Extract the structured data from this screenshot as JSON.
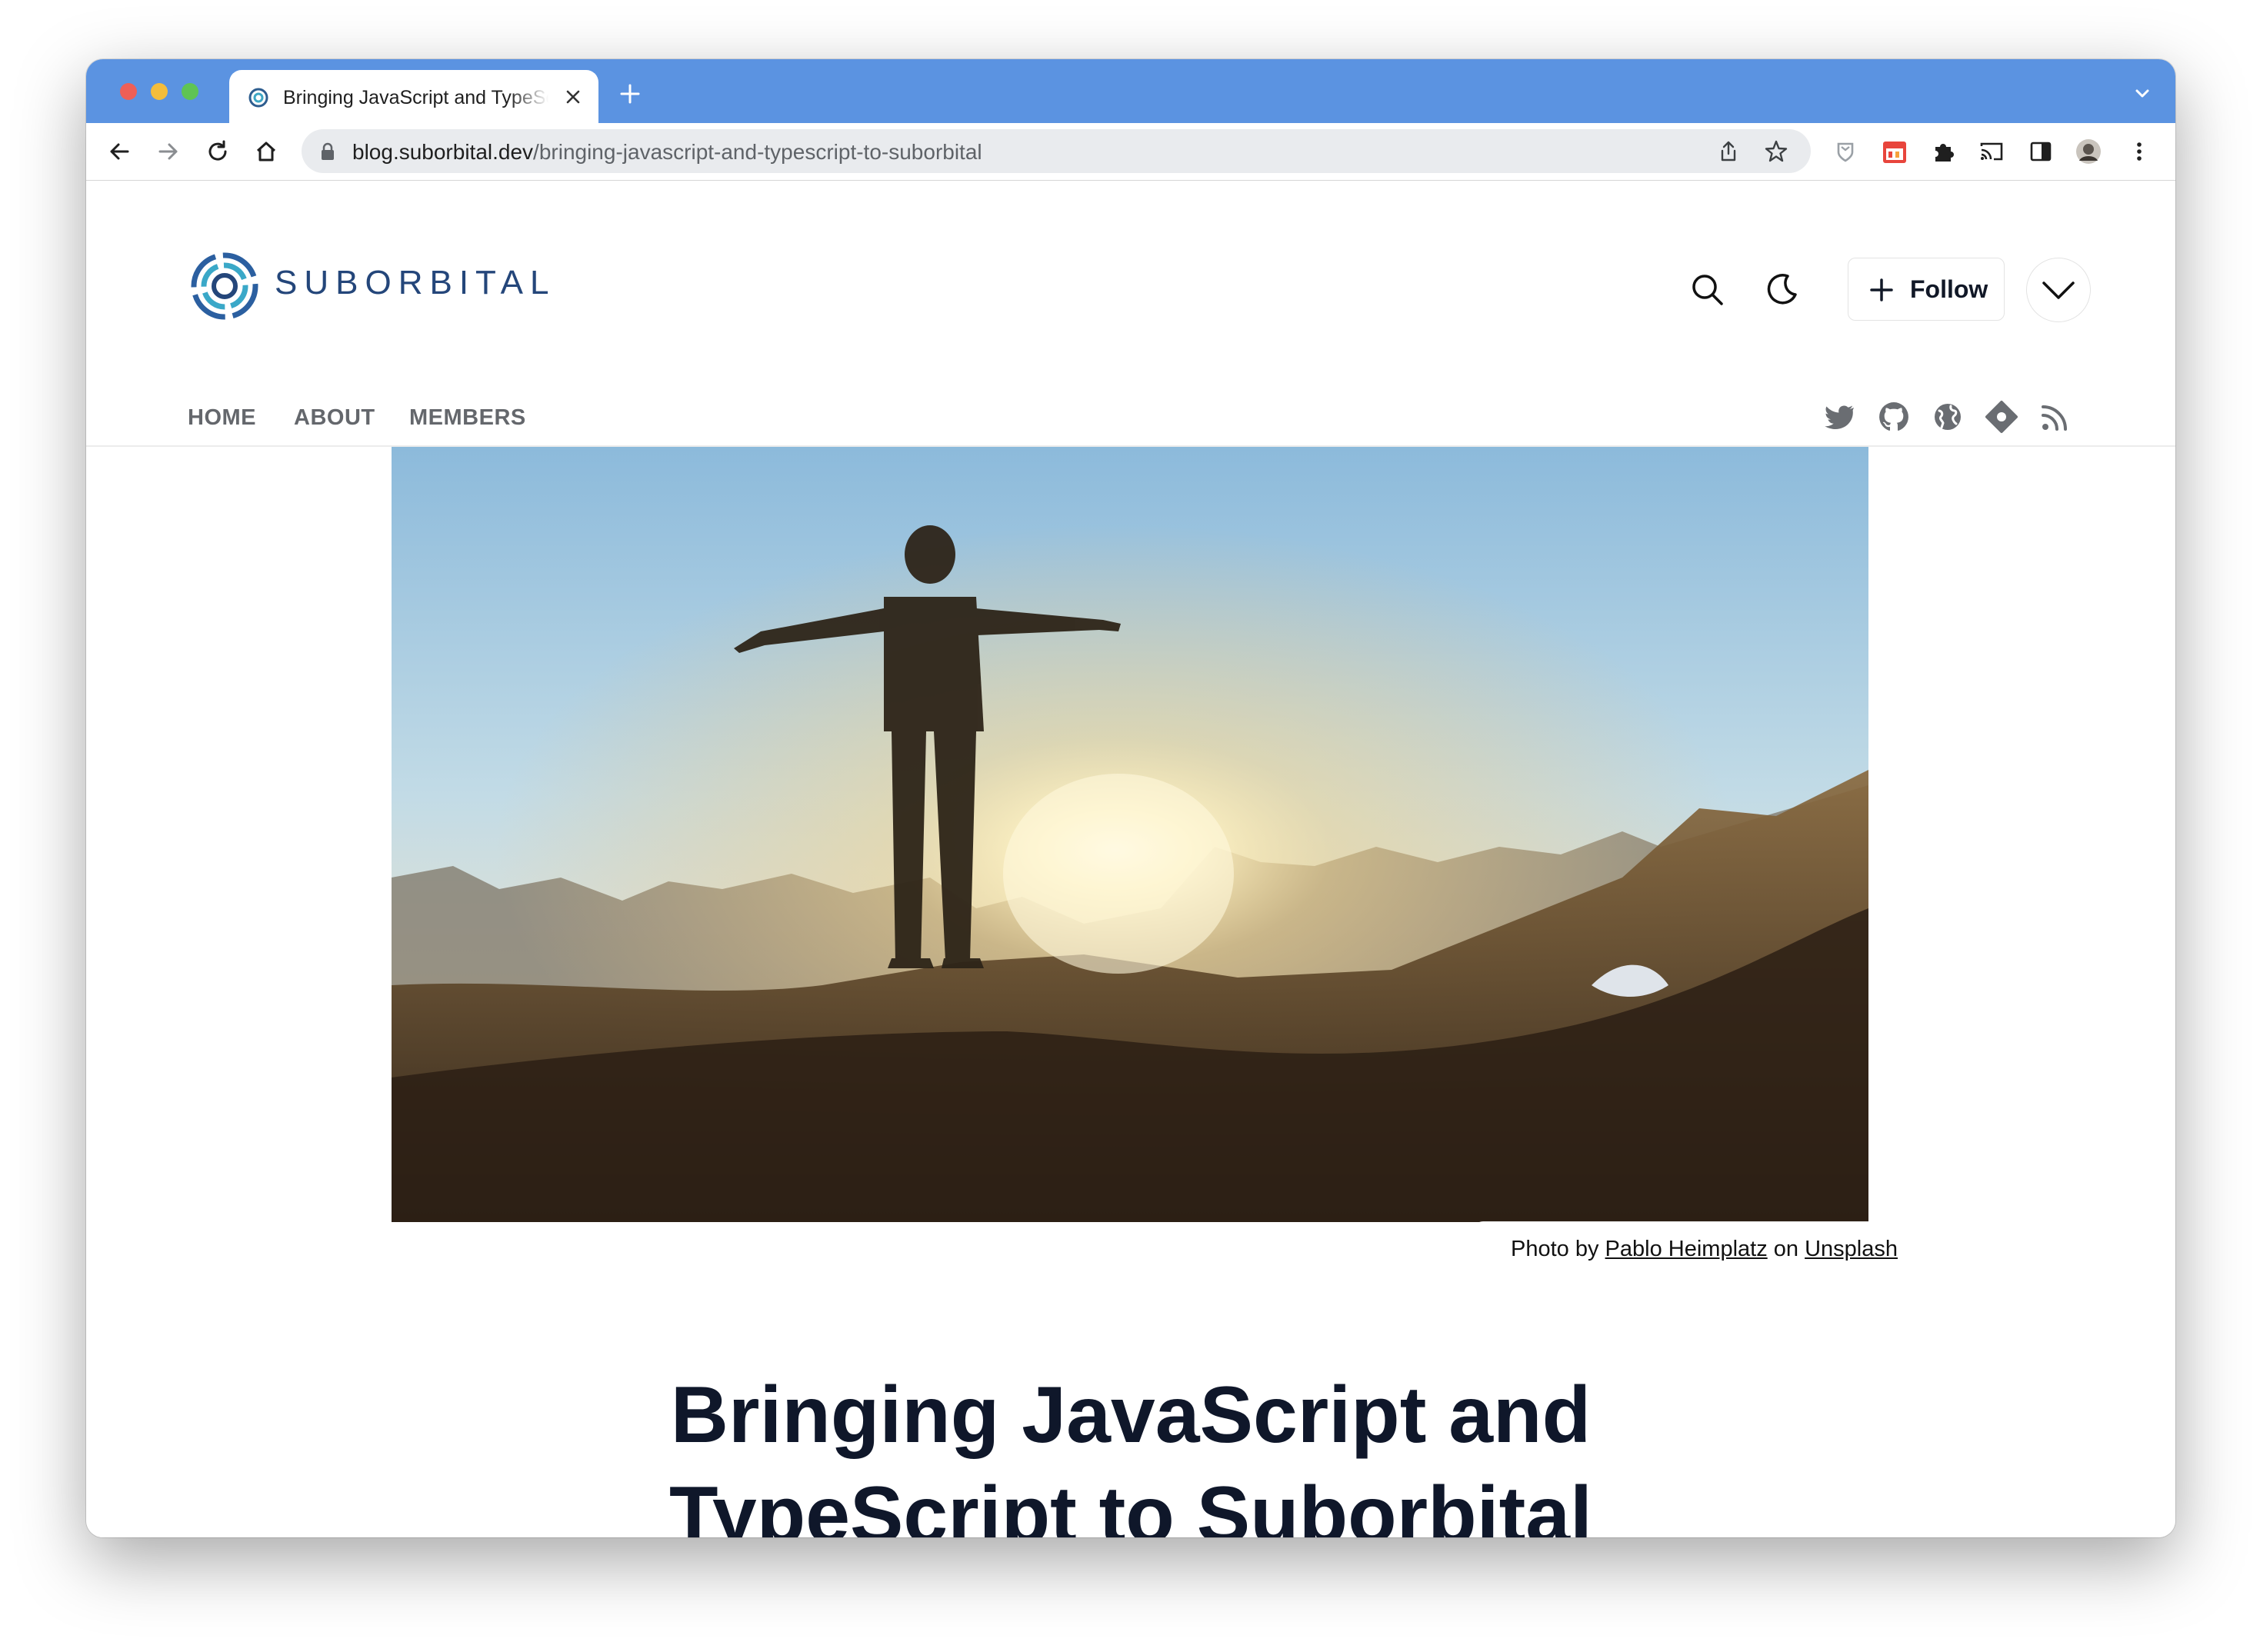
{
  "browser": {
    "tab_title": "Bringing JavaScript and TypeScript to Suborbital",
    "url_host": "blog.suborbital.dev",
    "url_path": "/bringing-javascript-and-typescript-to-suborbital",
    "icons": [
      "back-arrow-icon",
      "forward-arrow-icon",
      "reload-icon",
      "home-icon",
      "lock-icon",
      "share-icon",
      "star-icon",
      "extension-icon",
      "puzzle-icon",
      "cast-icon",
      "sidepanel-icon",
      "profile-avatar",
      "kebab-menu-icon"
    ]
  },
  "site": {
    "brand": "SUBORBITAL",
    "follow_label": "Follow",
    "nav": [
      "HOME",
      "ABOUT",
      "MEMBERS"
    ],
    "social_icons": [
      "twitter-icon",
      "github-icon",
      "globe-icon",
      "discord-icon",
      "rss-icon"
    ]
  },
  "hero": {
    "credit_prefix": "Photo by",
    "credit_author": "Pablo Heimplatz",
    "credit_mid": "on",
    "credit_source": "Unsplash"
  },
  "article": {
    "title_line1": "Bringing JavaScript and",
    "title_line2": "TypeScript to Suborbital"
  },
  "colors": {
    "titlebar": "#5b93e1",
    "brand": "#24467a",
    "headline": "#0f172a"
  }
}
